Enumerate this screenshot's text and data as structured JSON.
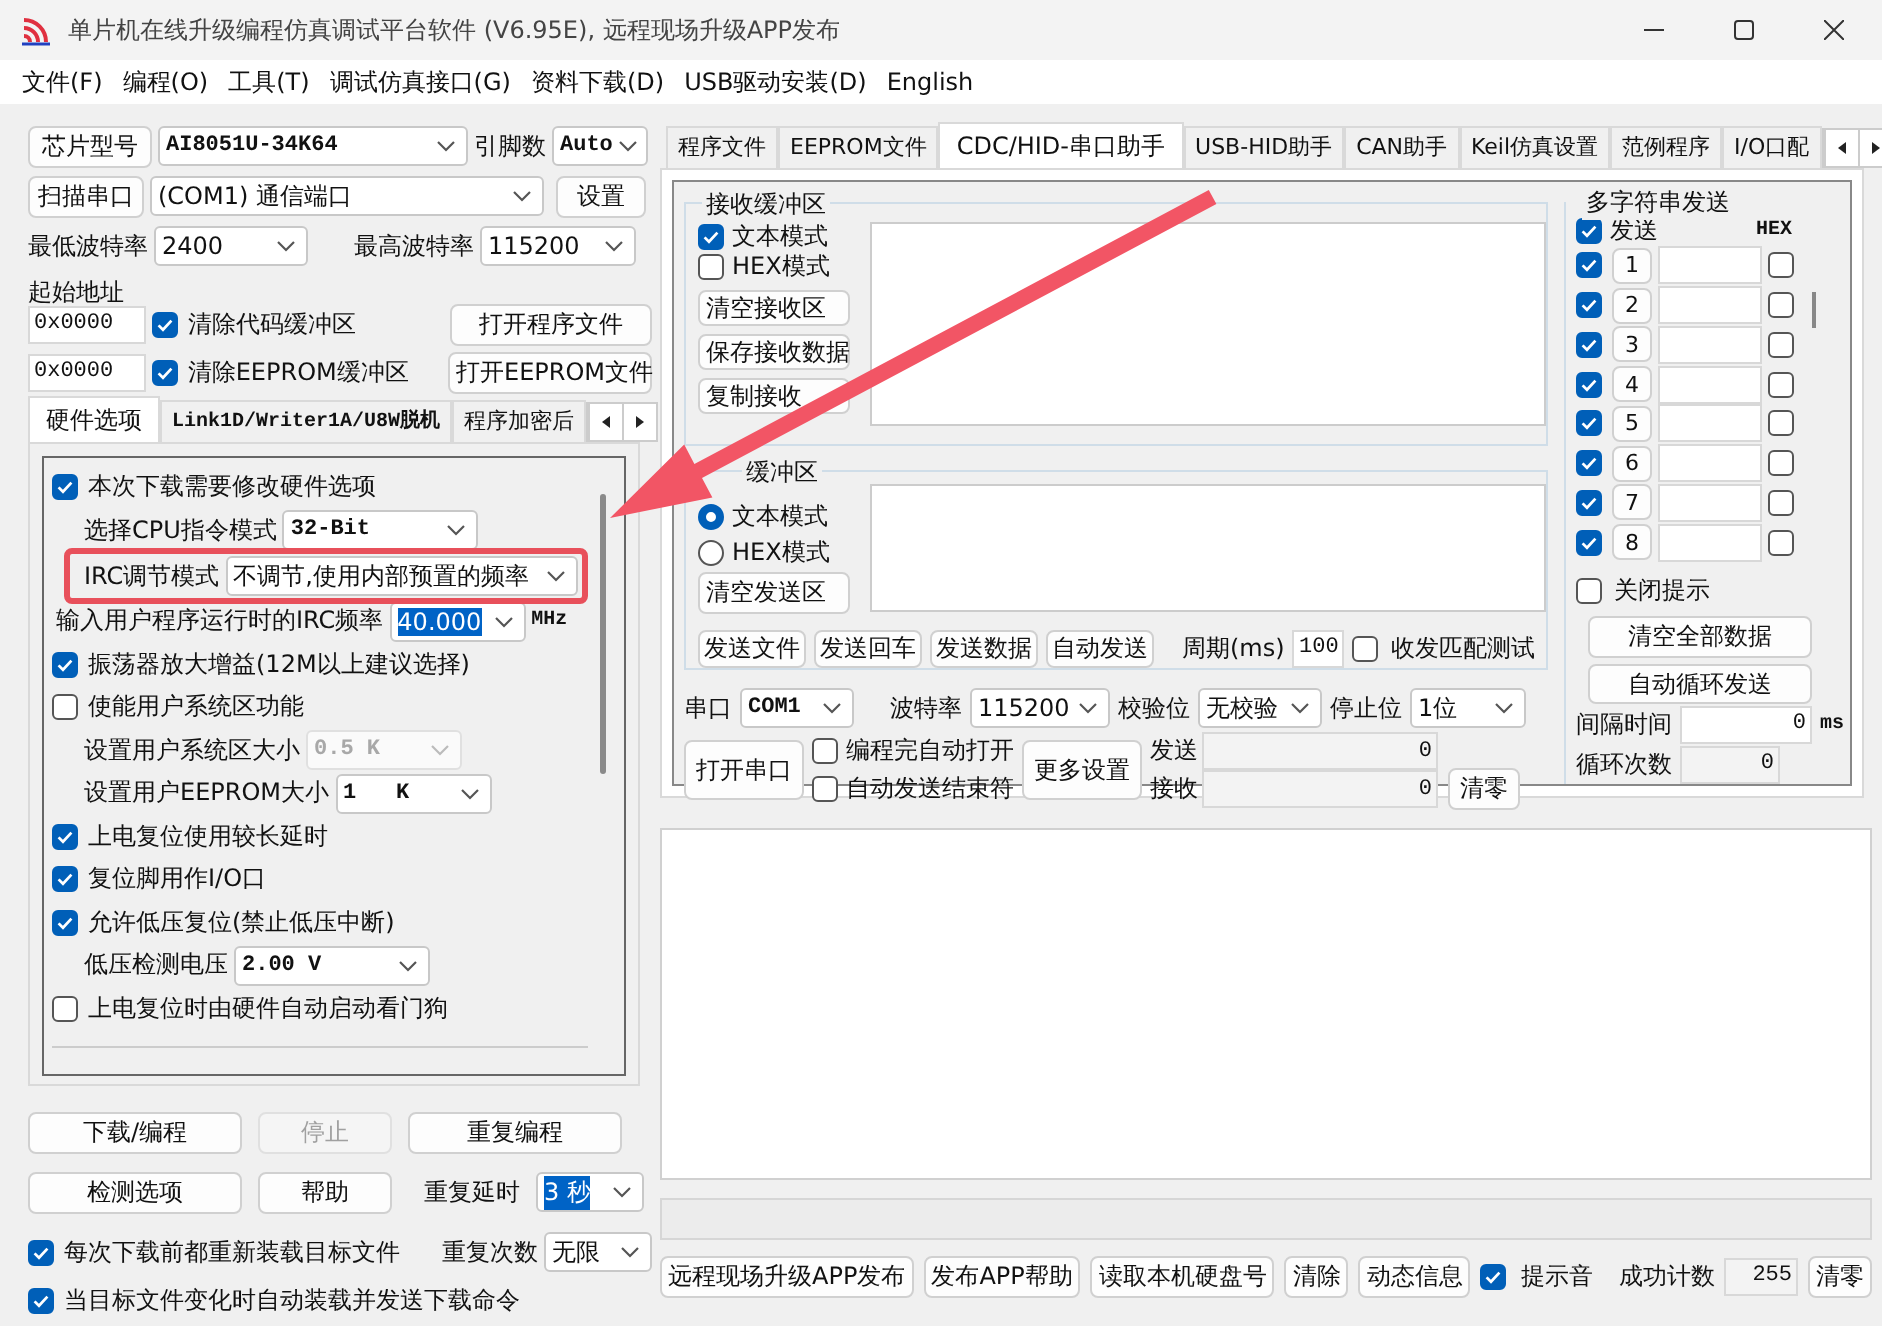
{
  "window": {
    "title": "单片机在线升级编程仿真调试平台软件 (V6.95E), 远程现场升级APP发布"
  },
  "menu": [
    "文件(F)",
    "编程(O)",
    "工具(T)",
    "调试仿真接口(G)",
    "资料下载(D)",
    "USB驱动安装(D)",
    "English"
  ],
  "chip": {
    "button": "芯片型号",
    "value": "AI8051U-34K64",
    "pins_label": "引脚数",
    "pins_value": "Auto"
  },
  "port": {
    "button": "扫描串口",
    "value": "(COM1) 通信端口",
    "settings": "设置"
  },
  "baud": {
    "min_label": "最低波特率",
    "min": "2400",
    "max_label": "最高波特率",
    "max": "115200"
  },
  "start_address": {
    "label": "起始地址",
    "rows": [
      {
        "value": "0x0000",
        "check": "清除代码缓冲区",
        "checked": true,
        "button": "打开程序文件"
      },
      {
        "value": "0x0000",
        "check": "清除EEPROM缓冲区",
        "checked": true,
        "button": "打开EEPROM文件"
      }
    ]
  },
  "left_tabs": [
    {
      "label": "硬件选项",
      "selected": true
    },
    {
      "label": "Link1D/Writer1A/U8W脱机",
      "selected": false
    },
    {
      "label": "程序加密后",
      "selected": false
    }
  ],
  "hardware_options": [
    {
      "kind": "check",
      "label": "本次下载需要修改硬件选项",
      "checked": true
    },
    {
      "kind": "select",
      "label": "选择CPU指令模式",
      "value": "32-Bit",
      "disabled": false
    },
    {
      "kind": "select",
      "label": "IRC调节模式",
      "value": "不调节,使用内部预置的频率",
      "disabled": false,
      "highlighted": true
    },
    {
      "kind": "combo",
      "label": "输入用户程序运行时的IRC频率",
      "value": "40.000",
      "text_selected": true,
      "unit": "MHz"
    },
    {
      "kind": "check",
      "label": "振荡器放大增益(12M以上建议选择)",
      "checked": true
    },
    {
      "kind": "check",
      "label": "使能用户系统区功能",
      "checked": false
    },
    {
      "kind": "select",
      "label": "设置用户系统区大小",
      "value": "0.5 K",
      "disabled": true
    },
    {
      "kind": "select",
      "label": "设置用户EEPROM大小",
      "value": "1   K",
      "disabled": false
    },
    {
      "kind": "check",
      "label": "上电复位使用较长延时",
      "checked": true
    },
    {
      "kind": "check",
      "label": "复位脚用作I/O口",
      "checked": true
    },
    {
      "kind": "check",
      "label": "允许低压复位(禁止低压中断)",
      "checked": true
    },
    {
      "kind": "select",
      "label": "低压检测电压",
      "value": "2.00 V",
      "disabled": false
    },
    {
      "kind": "check",
      "label": "上电复位时由硬件自动启动看门狗",
      "checked": false
    }
  ],
  "actions": [
    {
      "label": "下载/编程",
      "disabled": false
    },
    {
      "label": "停止",
      "disabled": true
    },
    {
      "label": "重复编程",
      "disabled": false
    },
    {
      "label": "检测选项",
      "disabled": false
    },
    {
      "label": "帮助",
      "disabled": false
    }
  ],
  "repeat": {
    "delay_label": "重复延时",
    "delay": "3 秒",
    "delay_selected": true,
    "count_label": "重复次数",
    "count": "无限"
  },
  "reload_options": [
    {
      "label": "每次下载前都重新装载目标文件",
      "checked": true
    },
    {
      "label": "当目标文件变化时自动装载并发送下载命令",
      "checked": true
    }
  ],
  "right_tabs": [
    {
      "label": "程序文件",
      "selected": false
    },
    {
      "label": "EEPROM文件",
      "selected": false
    },
    {
      "label": "CDC/HID-串口助手",
      "selected": true
    },
    {
      "label": "USB-HID助手",
      "selected": false
    },
    {
      "label": "CAN助手",
      "selected": false
    },
    {
      "label": "Keil仿真设置",
      "selected": false
    },
    {
      "label": "范例程序",
      "selected": false
    },
    {
      "label": "I/O口配",
      "selected": false
    }
  ],
  "receive": {
    "title": "接收缓冲区",
    "modes": [
      {
        "label": "文本模式",
        "checked": true
      },
      {
        "label": "HEX模式",
        "checked": false
      }
    ],
    "buttons": [
      "清空接收区",
      "保存接收数据",
      "复制接收"
    ]
  },
  "send": {
    "title": "缓冲区",
    "modes": [
      {
        "label": "文本模式",
        "selected": true
      },
      {
        "label": "HEX模式",
        "selected": false
      }
    ],
    "clear": "清空发送区",
    "actions": [
      "发送文件",
      "发送回车",
      "发送数据",
      "自动发送"
    ],
    "period_label": "周期(ms)",
    "period": "100",
    "match": {
      "label": "收发匹配测试",
      "checked": false
    }
  },
  "serial": {
    "port_label": "串口",
    "port": "COM1",
    "baud_label": "波特率",
    "baud": "115200",
    "parity_label": "校验位",
    "parity": "无校验",
    "stop_label": "停止位",
    "stop": "1位",
    "open": "打开串口",
    "options": [
      {
        "label": "编程完自动打开",
        "checked": false
      },
      {
        "label": "自动发送结束符",
        "checked": false
      }
    ],
    "more": "更多设置",
    "sent_label": "发送",
    "sent": "0",
    "recv_label": "接收",
    "recv": "0",
    "clear": "清零"
  },
  "multi": {
    "title": "多字符串发送",
    "send_all": {
      "label": "发送",
      "checked": true
    },
    "hex_label": "HEX",
    "rows": [
      {
        "label": "1",
        "checked": true,
        "hex": false
      },
      {
        "label": "2",
        "checked": true,
        "hex": false
      },
      {
        "label": "3",
        "checked": true,
        "hex": false
      },
      {
        "label": "4",
        "checked": true,
        "hex": false
      },
      {
        "label": "5",
        "checked": true,
        "hex": false
      },
      {
        "label": "6",
        "checked": true,
        "hex": false
      },
      {
        "label": "7",
        "checked": true,
        "hex": false
      },
      {
        "label": "8",
        "checked": true,
        "hex": false
      }
    ],
    "close_tip": {
      "label": "关闭提示",
      "checked": false
    },
    "buttons": [
      "清空全部数据",
      "自动循环发送"
    ],
    "interval_label": "间隔时间",
    "interval": "0",
    "interval_unit": "ms",
    "loops_label": "循环次数",
    "loops": "0"
  },
  "progress": {
    "level": 0
  },
  "footer": {
    "buttons": [
      "远程现场升级APP发布",
      "发布APP帮助",
      "读取本机硬盘号",
      "清除",
      "动态信息"
    ],
    "beep": {
      "label": "提示音",
      "checked": true
    },
    "count_label": "成功计数",
    "count": "255",
    "clear": "清零"
  }
}
